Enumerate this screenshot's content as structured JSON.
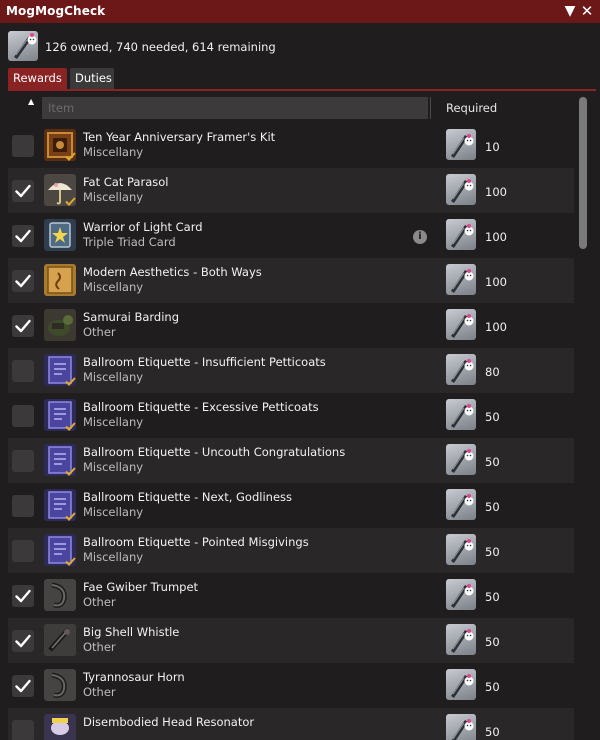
{
  "window": {
    "title": "MogMogCheck",
    "collapse_glyph": "▼",
    "close_glyph": "✕"
  },
  "summary": {
    "text": "126 owned, 740 needed, 614 remaining",
    "icon": "mogpendium-token-icon"
  },
  "tabs": [
    {
      "label": "Rewards",
      "active": true
    },
    {
      "label": "Duties",
      "active": false
    }
  ],
  "table": {
    "sort_indicator": "▲",
    "columns": {
      "item": "Item",
      "required": "Required"
    },
    "rows": [
      {
        "checked": false,
        "name": "Ten Year Anniversary Framer's Kit",
        "category": "Miscellany",
        "icon": "framers-kit-icon",
        "owned_badge": true,
        "info": false,
        "required": "10"
      },
      {
        "checked": true,
        "name": "Fat Cat Parasol",
        "category": "Miscellany",
        "icon": "parasol-icon",
        "owned_badge": true,
        "info": false,
        "required": "100"
      },
      {
        "checked": true,
        "name": "Warrior of Light Card",
        "category": "Triple Triad Card",
        "icon": "triad-card-icon",
        "owned_badge": false,
        "info": true,
        "required": "100"
      },
      {
        "checked": true,
        "name": "Modern Aesthetics - Both Ways",
        "category": "Miscellany",
        "icon": "hairstyle-scroll-icon",
        "owned_badge": false,
        "info": false,
        "required": "100"
      },
      {
        "checked": true,
        "name": "Samurai Barding",
        "category": "Other",
        "icon": "barding-icon",
        "owned_badge": false,
        "info": false,
        "required": "100"
      },
      {
        "checked": false,
        "name": "Ballroom Etiquette - Insufficient Petticoats",
        "category": "Miscellany",
        "icon": "emote-book-icon",
        "owned_badge": true,
        "info": false,
        "required": "80"
      },
      {
        "checked": false,
        "name": "Ballroom Etiquette - Excessive Petticoats",
        "category": "Miscellany",
        "icon": "emote-book-icon",
        "owned_badge": true,
        "info": false,
        "required": "50"
      },
      {
        "checked": false,
        "name": "Ballroom Etiquette - Uncouth Congratulations",
        "category": "Miscellany",
        "icon": "emote-book-icon",
        "owned_badge": true,
        "info": false,
        "required": "50"
      },
      {
        "checked": false,
        "name": "Ballroom Etiquette - Next, Godliness",
        "category": "Miscellany",
        "icon": "emote-book-icon",
        "owned_badge": true,
        "info": false,
        "required": "50"
      },
      {
        "checked": false,
        "name": "Ballroom Etiquette - Pointed Misgivings",
        "category": "Miscellany",
        "icon": "emote-book-icon",
        "owned_badge": true,
        "info": false,
        "required": "50"
      },
      {
        "checked": true,
        "name": "Fae Gwiber Trumpet",
        "category": "Other",
        "icon": "horn-icon",
        "owned_badge": false,
        "info": false,
        "required": "50"
      },
      {
        "checked": true,
        "name": "Big Shell Whistle",
        "category": "Other",
        "icon": "whistle-icon",
        "owned_badge": false,
        "info": false,
        "required": "50"
      },
      {
        "checked": true,
        "name": "Tyrannosaur Horn",
        "category": "Other",
        "icon": "horn-icon",
        "owned_badge": false,
        "info": false,
        "required": "50"
      },
      {
        "checked": false,
        "name": "Disembodied Head Resonator",
        "category": "",
        "icon": "resonator-icon",
        "owned_badge": false,
        "info": false,
        "required": "50"
      }
    ]
  },
  "info_glyph": "i",
  "colors": {
    "titlebar": "#6d1818",
    "tab_active": "#8a2323",
    "tab_inactive": "#3a3a3a",
    "background": "#201d1e",
    "row_alt": "#2a2728",
    "owned_badge": "#e0a92a"
  }
}
